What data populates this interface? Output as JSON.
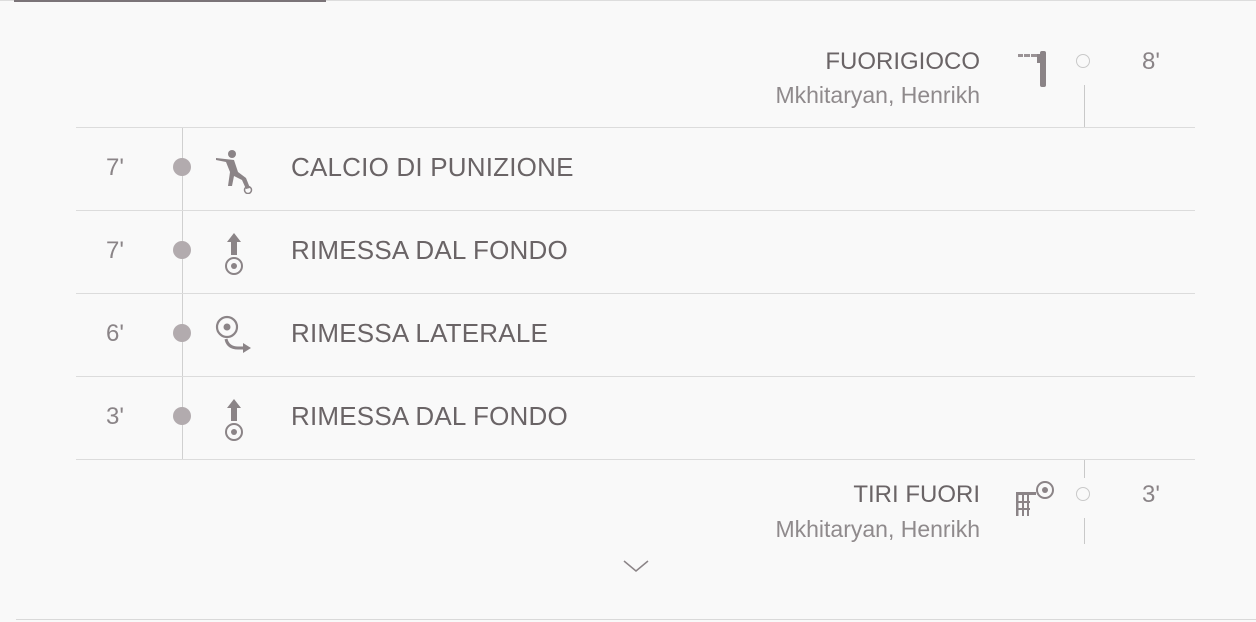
{
  "events": [
    {
      "side": "right",
      "title": "FUORIGIOCO",
      "player": "Mkhitaryan, Henrikh",
      "minute": "8'",
      "icon": "offside-flag-icon"
    },
    {
      "side": "left",
      "title": "CALCIO DI PUNIZIONE",
      "minute": "7'",
      "icon": "free-kick-icon"
    },
    {
      "side": "left",
      "title": "RIMESSA DAL FONDO",
      "minute": "7'",
      "icon": "goal-kick-icon"
    },
    {
      "side": "left",
      "title": "RIMESSA LATERALE",
      "minute": "6'",
      "icon": "throw-in-icon"
    },
    {
      "side": "left",
      "title": "RIMESSA DAL FONDO",
      "minute": "3'",
      "icon": "goal-kick-icon"
    },
    {
      "side": "right",
      "title": "TIRI FUORI",
      "player": "Mkhitaryan, Henrikh",
      "minute": "3'",
      "icon": "shot-off-target-icon"
    }
  ],
  "controls": {
    "more_icon": "chevron-down-icon"
  },
  "colors": {
    "text": "#6a6466",
    "muted": "#8f8a8c",
    "dot": "#b2abae",
    "divider": "#dcdcdc",
    "background": "#f9f9f9"
  }
}
